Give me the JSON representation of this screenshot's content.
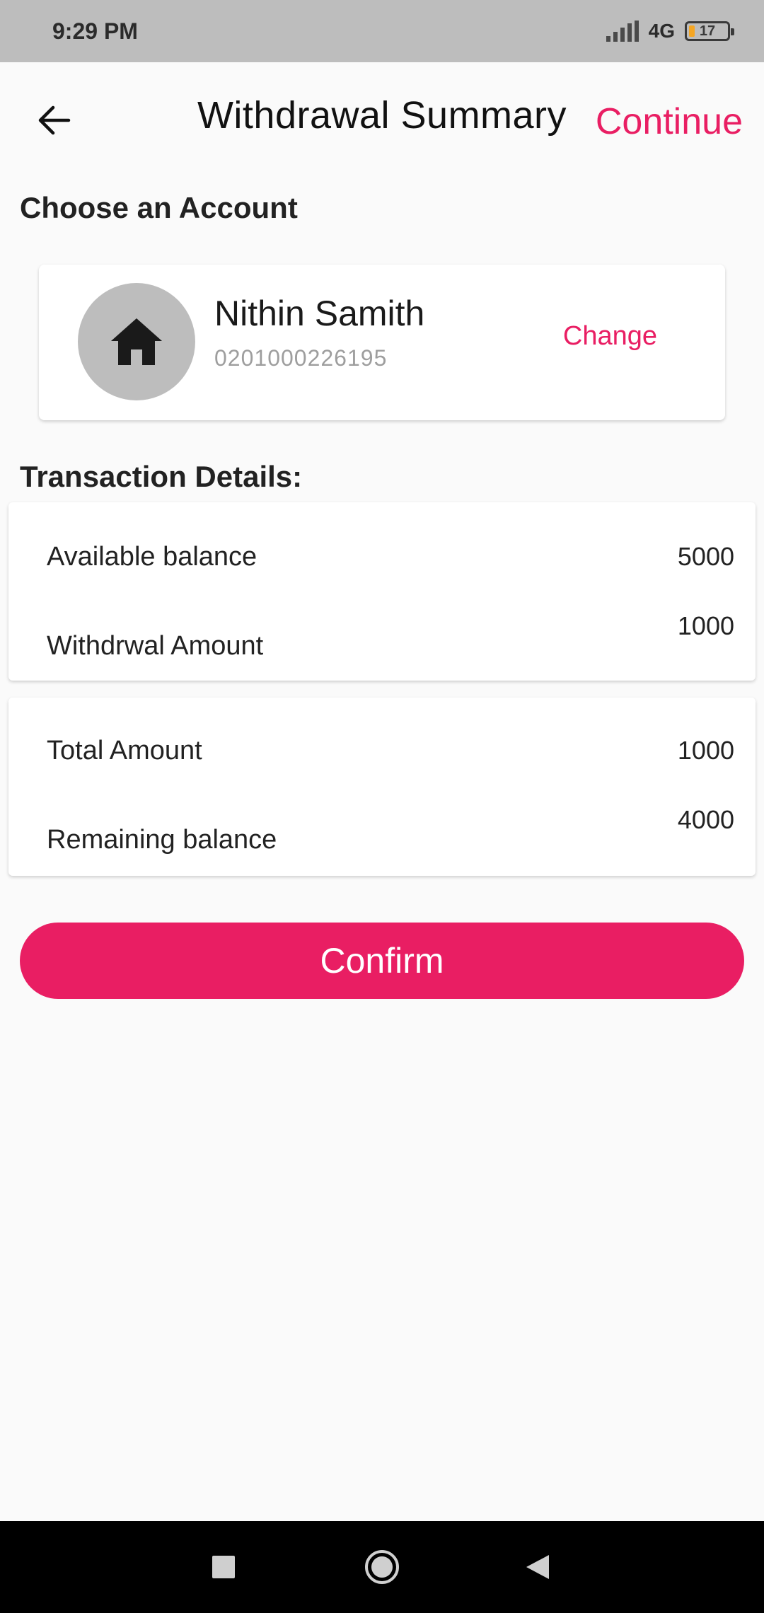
{
  "status_bar": {
    "time": "9:29 PM",
    "network": "4G",
    "battery_level": "17"
  },
  "app_bar": {
    "title": "Withdrawal Summary",
    "continue_label": "Continue"
  },
  "account_section": {
    "heading": "Choose an Account",
    "account_name": "Nithin Samith",
    "account_number": "0201000226195",
    "change_label": "Change",
    "avatar_icon": "home-icon"
  },
  "transaction_section": {
    "heading": "Transaction Details:",
    "card1": {
      "available_label": "Available balance",
      "available_value": "5000",
      "withdrawal_label": "Withdrwal Amount",
      "withdrawal_value": "1000"
    },
    "card2": {
      "total_label": "Total Amount",
      "total_value": "1000",
      "remaining_label": "Remaining balance",
      "remaining_value": "4000"
    }
  },
  "confirm_label": "Confirm",
  "colors": {
    "accent": "#e91e63",
    "status_bar": "#bdbdbd",
    "avatar_bg": "#bdbdbd"
  }
}
